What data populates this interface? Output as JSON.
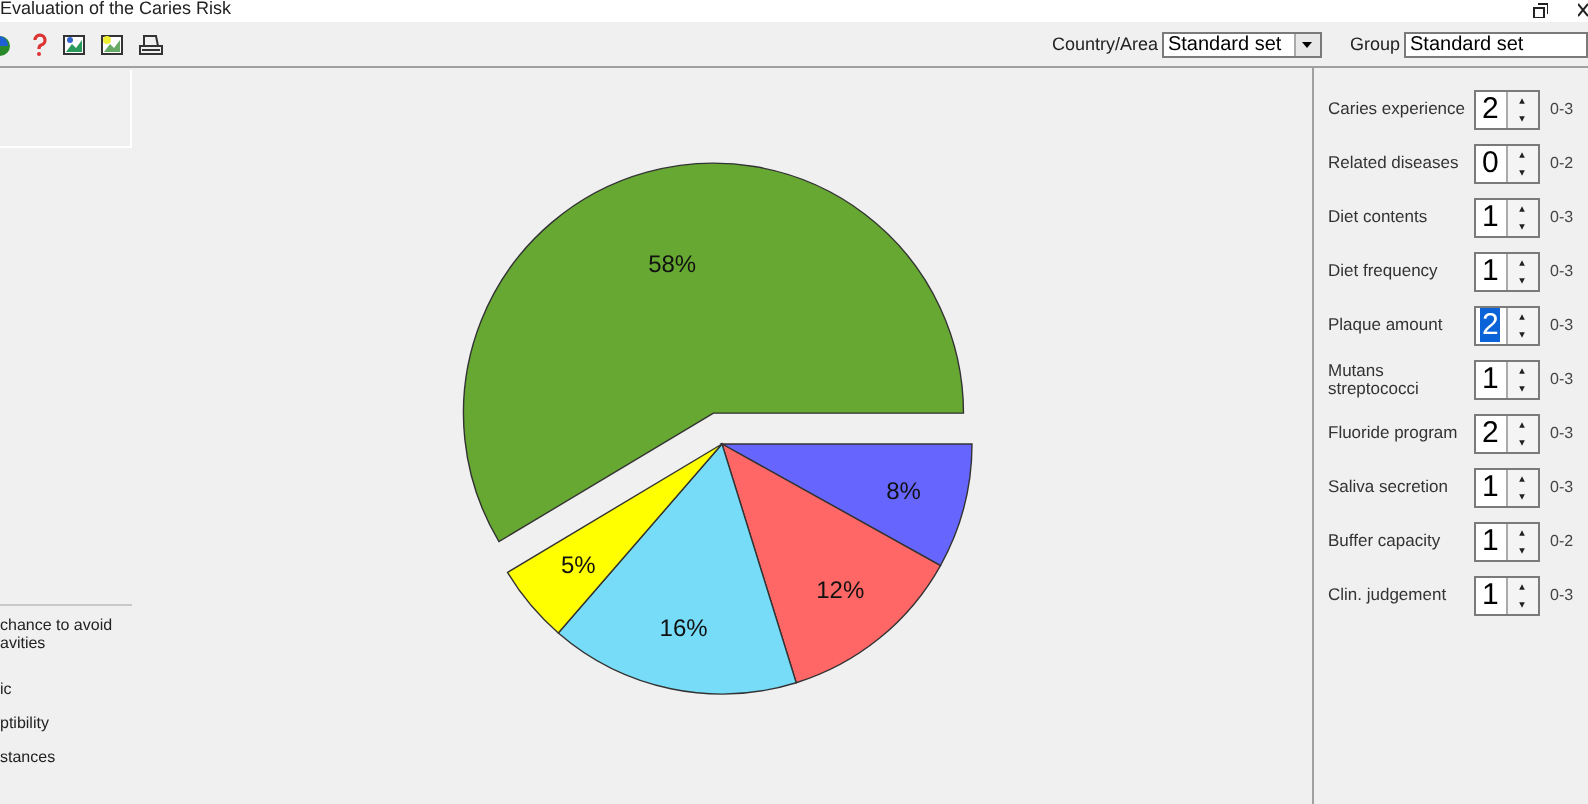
{
  "window": {
    "title": "Evaluation of the Caries Risk"
  },
  "toolbar": {
    "country": {
      "label": "Country/Area",
      "value": "Standard set"
    },
    "group": {
      "label": "Group",
      "value": "Standard set"
    }
  },
  "legend": {
    "lines": [
      "chance to avoid",
      "avities",
      "ic",
      "ptibility",
      "stances"
    ]
  },
  "chart": {
    "chart_data": {
      "type": "pie",
      "values": [
        8,
        12,
        16,
        5,
        58
      ],
      "colors": [
        "#6666ff",
        "#ff6666",
        "#77dcf8",
        "#ffff00",
        "#66a832"
      ],
      "value_labels": [
        "8%",
        "12%",
        "16%",
        "5%",
        "58%"
      ]
    }
  },
  "factors": [
    {
      "label": "Caries experience",
      "value": "2",
      "range": "0-3",
      "highlighted": false
    },
    {
      "label": "Related diseases",
      "value": "0",
      "range": "0-2",
      "highlighted": false
    },
    {
      "label": "Diet contents",
      "value": "1",
      "range": "0-3",
      "highlighted": false
    },
    {
      "label": "Diet frequency",
      "value": "1",
      "range": "0-3",
      "highlighted": false
    },
    {
      "label": "Plaque amount",
      "value": "2",
      "range": "0-3",
      "highlighted": true
    },
    {
      "label": "Mutans streptococci",
      "value": "1",
      "range": "0-3",
      "highlighted": false
    },
    {
      "label": "Fluoride program",
      "value": "2",
      "range": "0-3",
      "highlighted": false
    },
    {
      "label": "Saliva secretion",
      "value": "1",
      "range": "0-3",
      "highlighted": false
    },
    {
      "label": "Buffer capacity",
      "value": "1",
      "range": "0-2",
      "highlighted": false
    },
    {
      "label": "Clin. judgement",
      "value": "1",
      "range": "0-3",
      "highlighted": false
    }
  ]
}
